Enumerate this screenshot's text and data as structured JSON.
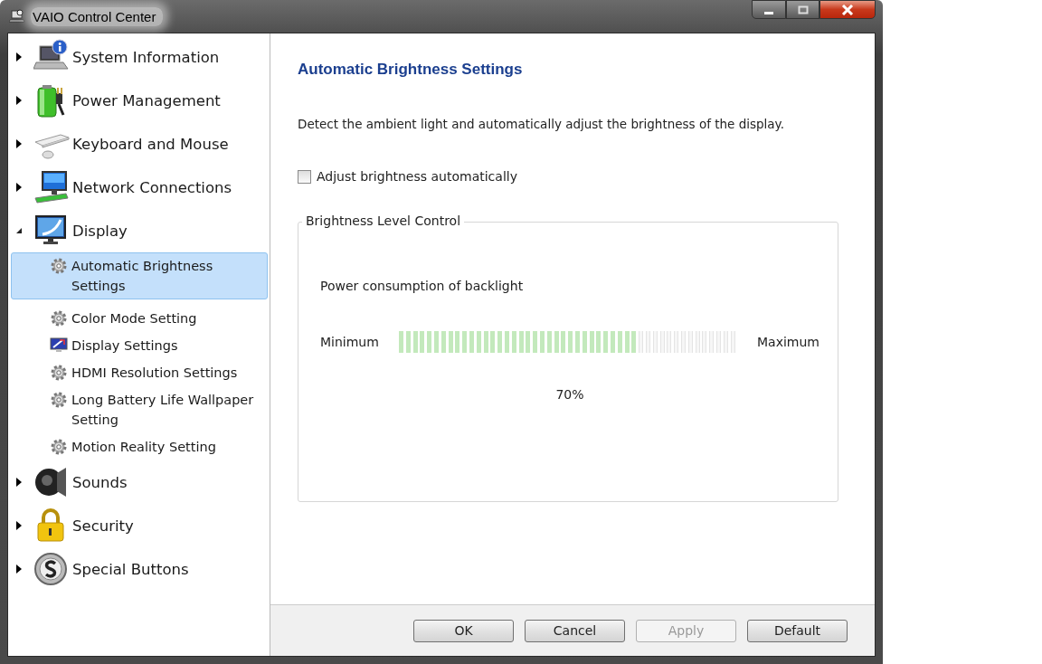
{
  "window": {
    "title": "VAIO Control Center"
  },
  "sidebar": {
    "items": [
      {
        "label": "System Information",
        "kind": "laptop",
        "expanded": false,
        "selected": false
      },
      {
        "label": "Power Management",
        "kind": "battery",
        "expanded": false,
        "selected": false
      },
      {
        "label": "Keyboard and Mouse",
        "kind": "keyboard",
        "expanded": false,
        "selected": false
      },
      {
        "label": "Network Connections",
        "kind": "network",
        "expanded": false,
        "selected": false
      },
      {
        "label": "Display",
        "kind": "monitor",
        "expanded": true,
        "selected": false,
        "children": [
          {
            "label": "Automatic Brightness Settings",
            "kind": "gear",
            "selected": true
          },
          {
            "label": "Color Mode Setting",
            "kind": "gear",
            "selected": false
          },
          {
            "label": "Display Settings",
            "kind": "screen",
            "selected": false
          },
          {
            "label": "HDMI Resolution Settings",
            "kind": "gear",
            "selected": false
          },
          {
            "label": "Long Battery Life Wallpaper Setting",
            "kind": "gear",
            "selected": false
          },
          {
            "label": "Motion Reality Setting",
            "kind": "gear",
            "selected": false
          }
        ]
      },
      {
        "label": "Sounds",
        "kind": "speaker",
        "expanded": false,
        "selected": false
      },
      {
        "label": "Security",
        "kind": "lock",
        "expanded": false,
        "selected": false
      },
      {
        "label": "Special Buttons",
        "kind": "special",
        "expanded": false,
        "selected": false
      }
    ]
  },
  "content": {
    "heading": "Automatic Brightness Settings",
    "description": "Detect the ambient light and automatically adjust the brightness of the display.",
    "checkbox": {
      "label": "Adjust brightness automatically",
      "checked": false
    },
    "group": {
      "title": "Brightness Level Control",
      "subtitle": "Power consumption of backlight",
      "min_label": "Minimum",
      "max_label": "Maximum",
      "level": 0.7,
      "reading": "70%"
    }
  },
  "buttons": [
    {
      "label": "OK",
      "disabled": false
    },
    {
      "label": "Cancel",
      "disabled": false
    },
    {
      "label": "Apply",
      "disabled": true
    },
    {
      "label": "Default",
      "disabled": false
    }
  ]
}
